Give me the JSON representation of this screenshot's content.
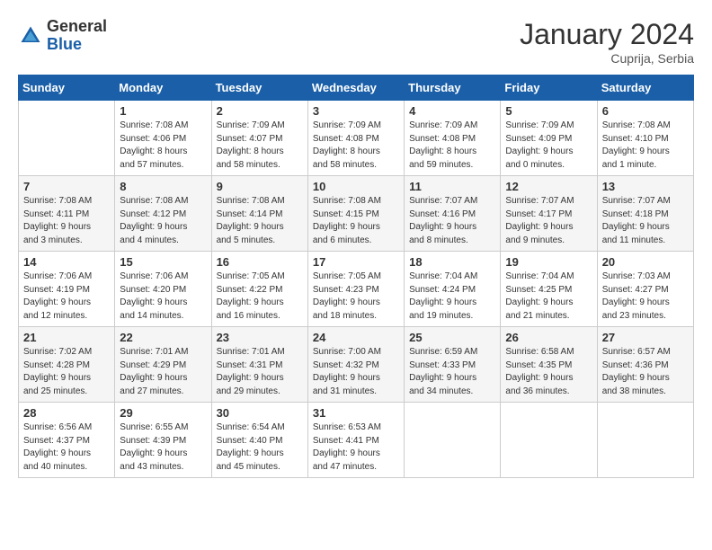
{
  "header": {
    "logo_general": "General",
    "logo_blue": "Blue",
    "month_title": "January 2024",
    "location": "Cuprija, Serbia"
  },
  "weekdays": [
    "Sunday",
    "Monday",
    "Tuesday",
    "Wednesday",
    "Thursday",
    "Friday",
    "Saturday"
  ],
  "weeks": [
    [
      {
        "day": "",
        "info": ""
      },
      {
        "day": "1",
        "info": "Sunrise: 7:08 AM\nSunset: 4:06 PM\nDaylight: 8 hours\nand 57 minutes."
      },
      {
        "day": "2",
        "info": "Sunrise: 7:09 AM\nSunset: 4:07 PM\nDaylight: 8 hours\nand 58 minutes."
      },
      {
        "day": "3",
        "info": "Sunrise: 7:09 AM\nSunset: 4:08 PM\nDaylight: 8 hours\nand 58 minutes."
      },
      {
        "day": "4",
        "info": "Sunrise: 7:09 AM\nSunset: 4:08 PM\nDaylight: 8 hours\nand 59 minutes."
      },
      {
        "day": "5",
        "info": "Sunrise: 7:09 AM\nSunset: 4:09 PM\nDaylight: 9 hours\nand 0 minutes."
      },
      {
        "day": "6",
        "info": "Sunrise: 7:08 AM\nSunset: 4:10 PM\nDaylight: 9 hours\nand 1 minute."
      }
    ],
    [
      {
        "day": "7",
        "info": "Sunrise: 7:08 AM\nSunset: 4:11 PM\nDaylight: 9 hours\nand 3 minutes."
      },
      {
        "day": "8",
        "info": "Sunrise: 7:08 AM\nSunset: 4:12 PM\nDaylight: 9 hours\nand 4 minutes."
      },
      {
        "day": "9",
        "info": "Sunrise: 7:08 AM\nSunset: 4:14 PM\nDaylight: 9 hours\nand 5 minutes."
      },
      {
        "day": "10",
        "info": "Sunrise: 7:08 AM\nSunset: 4:15 PM\nDaylight: 9 hours\nand 6 minutes."
      },
      {
        "day": "11",
        "info": "Sunrise: 7:07 AM\nSunset: 4:16 PM\nDaylight: 9 hours\nand 8 minutes."
      },
      {
        "day": "12",
        "info": "Sunrise: 7:07 AM\nSunset: 4:17 PM\nDaylight: 9 hours\nand 9 minutes."
      },
      {
        "day": "13",
        "info": "Sunrise: 7:07 AM\nSunset: 4:18 PM\nDaylight: 9 hours\nand 11 minutes."
      }
    ],
    [
      {
        "day": "14",
        "info": "Sunrise: 7:06 AM\nSunset: 4:19 PM\nDaylight: 9 hours\nand 12 minutes."
      },
      {
        "day": "15",
        "info": "Sunrise: 7:06 AM\nSunset: 4:20 PM\nDaylight: 9 hours\nand 14 minutes."
      },
      {
        "day": "16",
        "info": "Sunrise: 7:05 AM\nSunset: 4:22 PM\nDaylight: 9 hours\nand 16 minutes."
      },
      {
        "day": "17",
        "info": "Sunrise: 7:05 AM\nSunset: 4:23 PM\nDaylight: 9 hours\nand 18 minutes."
      },
      {
        "day": "18",
        "info": "Sunrise: 7:04 AM\nSunset: 4:24 PM\nDaylight: 9 hours\nand 19 minutes."
      },
      {
        "day": "19",
        "info": "Sunrise: 7:04 AM\nSunset: 4:25 PM\nDaylight: 9 hours\nand 21 minutes."
      },
      {
        "day": "20",
        "info": "Sunrise: 7:03 AM\nSunset: 4:27 PM\nDaylight: 9 hours\nand 23 minutes."
      }
    ],
    [
      {
        "day": "21",
        "info": "Sunrise: 7:02 AM\nSunset: 4:28 PM\nDaylight: 9 hours\nand 25 minutes."
      },
      {
        "day": "22",
        "info": "Sunrise: 7:01 AM\nSunset: 4:29 PM\nDaylight: 9 hours\nand 27 minutes."
      },
      {
        "day": "23",
        "info": "Sunrise: 7:01 AM\nSunset: 4:31 PM\nDaylight: 9 hours\nand 29 minutes."
      },
      {
        "day": "24",
        "info": "Sunrise: 7:00 AM\nSunset: 4:32 PM\nDaylight: 9 hours\nand 31 minutes."
      },
      {
        "day": "25",
        "info": "Sunrise: 6:59 AM\nSunset: 4:33 PM\nDaylight: 9 hours\nand 34 minutes."
      },
      {
        "day": "26",
        "info": "Sunrise: 6:58 AM\nSunset: 4:35 PM\nDaylight: 9 hours\nand 36 minutes."
      },
      {
        "day": "27",
        "info": "Sunrise: 6:57 AM\nSunset: 4:36 PM\nDaylight: 9 hours\nand 38 minutes."
      }
    ],
    [
      {
        "day": "28",
        "info": "Sunrise: 6:56 AM\nSunset: 4:37 PM\nDaylight: 9 hours\nand 40 minutes."
      },
      {
        "day": "29",
        "info": "Sunrise: 6:55 AM\nSunset: 4:39 PM\nDaylight: 9 hours\nand 43 minutes."
      },
      {
        "day": "30",
        "info": "Sunrise: 6:54 AM\nSunset: 4:40 PM\nDaylight: 9 hours\nand 45 minutes."
      },
      {
        "day": "31",
        "info": "Sunrise: 6:53 AM\nSunset: 4:41 PM\nDaylight: 9 hours\nand 47 minutes."
      },
      {
        "day": "",
        "info": ""
      },
      {
        "day": "",
        "info": ""
      },
      {
        "day": "",
        "info": ""
      }
    ]
  ]
}
